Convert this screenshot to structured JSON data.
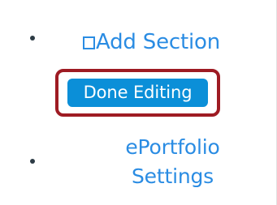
{
  "menu": {
    "add_section": {
      "label": "Add Section",
      "icon": "square-icon"
    },
    "done_editing_label": "Done Editing",
    "eportfolio_settings": {
      "line1": "ePortfolio",
      "line2": "Settings"
    }
  },
  "colors": {
    "link": "#2a8ce3",
    "button_bg": "#0b8fd8",
    "highlight_border": "#9e1b23",
    "bullet": "#2d3b45"
  }
}
